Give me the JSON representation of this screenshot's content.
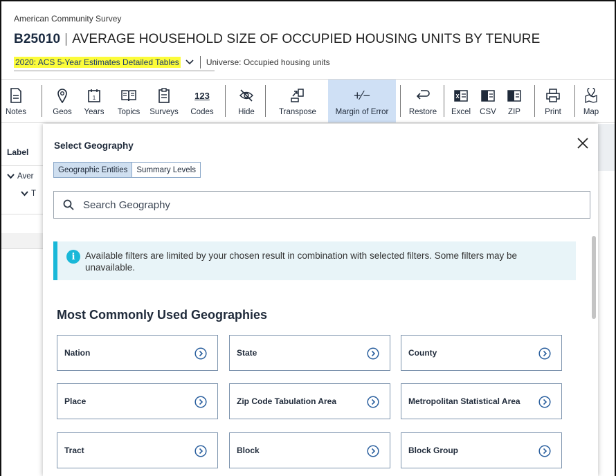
{
  "header": {
    "survey_name": "American Community Survey",
    "table_id": "B25010",
    "title_sep": "|",
    "table_title": "AVERAGE HOUSEHOLD SIZE OF OCCUPIED HOUSING UNITS BY TENURE",
    "dataset": "2020: ACS 5-Year Estimates Detailed Tables",
    "universe": "Universe: Occupied housing units",
    "dataset_highlight_color": "#fcfc3a"
  },
  "toolbar": {
    "items": [
      {
        "label": "Notes",
        "icon": "notes-icon"
      },
      {
        "label": "Geos",
        "icon": "location-pin-icon"
      },
      {
        "label": "Years",
        "icon": "calendar-icon"
      },
      {
        "label": "Topics",
        "icon": "book-icon"
      },
      {
        "label": "Surveys",
        "icon": "clipboard-icon"
      },
      {
        "label": "Codes",
        "icon": "codes-icon",
        "glyph": "123"
      },
      {
        "label": "Hide",
        "icon": "eye-off-icon"
      },
      {
        "label": "Transpose",
        "icon": "transpose-icon"
      },
      {
        "label": "Margin of Error",
        "icon": "plus-minus-icon",
        "glyph": "+⁄−",
        "active": true
      },
      {
        "label": "Restore",
        "icon": "restore-icon"
      },
      {
        "label": "Excel",
        "icon": "excel-icon"
      },
      {
        "label": "CSV",
        "icon": "csv-icon"
      },
      {
        "label": "ZIP",
        "icon": "zip-icon"
      },
      {
        "label": "Print",
        "icon": "print-icon"
      },
      {
        "label": "Map",
        "icon": "map-icon"
      }
    ],
    "active_color": "#cfe0f5"
  },
  "table": {
    "label_header": "Label",
    "row1": "Aver",
    "row2": "T"
  },
  "panel": {
    "title": "Select Geography",
    "tabs": [
      {
        "label": "Geographic Entities",
        "selected": true
      },
      {
        "label": "Summary Levels",
        "selected": false
      }
    ],
    "search_placeholder": "Search Geography",
    "info_text": "Available filters are limited by your chosen result in combination with selected filters. Some filters may be unavailable.",
    "info_color": "#19b8d8",
    "section_title": "Most Commonly Used Geographies",
    "geographies": [
      "Nation",
      "State",
      "County",
      "Place",
      "Zip Code Tabulation Area",
      "Metropolitan Statistical Area",
      "Tract",
      "Block",
      "Block Group"
    ]
  }
}
